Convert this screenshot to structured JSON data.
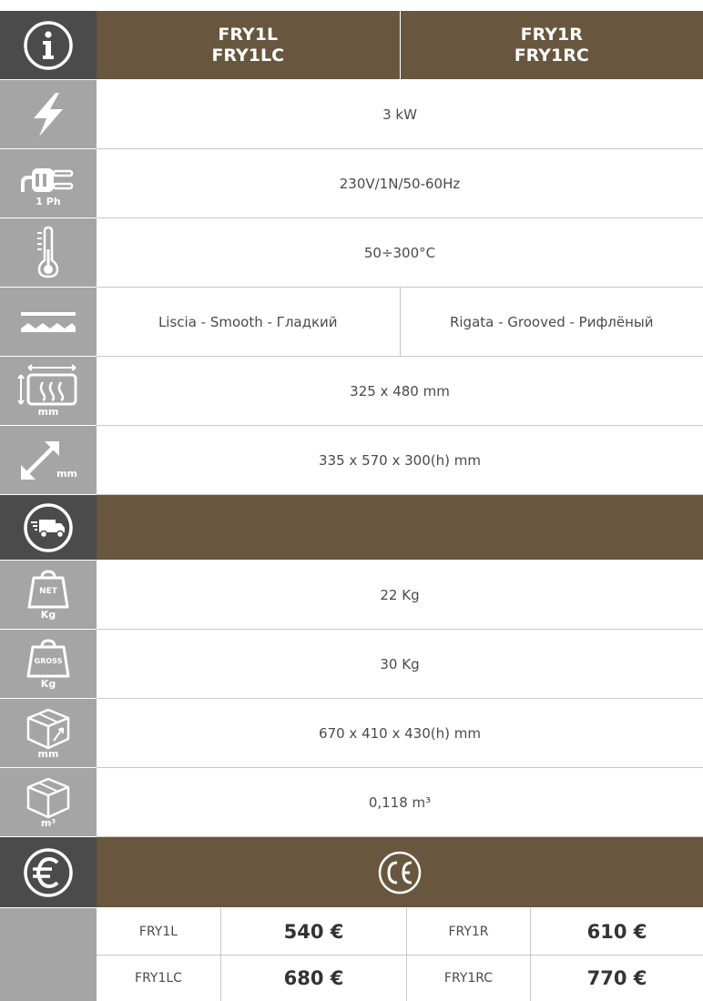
{
  "header": {
    "col1_line1": "FRY1L",
    "col1_line2": "FRY1LC",
    "col2_line1": "FRY1R",
    "col2_line2": "FRY1RC"
  },
  "specs": {
    "power": "3 kW",
    "voltage": "230V/1N/50-60Hz",
    "voltage_icon_label": "1 Ph",
    "temperature": "50÷300°C",
    "plate_left": "Liscia - Smooth - Гладкий",
    "plate_right": "Rigata - Grooved - Рифлёный",
    "cooking_surface": "325 x 480 mm",
    "cooking_surface_icon_label": "mm",
    "dimensions": "335 x 570 x 300(h) mm",
    "dimensions_icon_label": "mm"
  },
  "shipping": {
    "net_weight": "22 Kg",
    "net_icon_top": "NET",
    "net_icon_bottom": "Kg",
    "gross_weight": "30 Kg",
    "gross_icon_top": "GROSS",
    "gross_icon_bottom": "Kg",
    "package_dimensions": "670 x 410 x 430(h) mm",
    "package_dim_icon_label": "mm",
    "volume": "0,118 m³",
    "volume_icon_label": "m³"
  },
  "prices": {
    "rows": [
      {
        "model_a": "FRY1L",
        "price_a": "540 €",
        "model_b": "FRY1R",
        "price_b": "610 €"
      },
      {
        "model_a": "FRY1LC",
        "price_a": "680 €",
        "model_b": "FRY1RC",
        "price_b": "770 €"
      }
    ]
  },
  "colors": {
    "brown": "#68563f",
    "grey_icon": "#a5a5a5",
    "dark_icon": "#4b4b4b"
  },
  "icons": [
    "info-icon",
    "lightning-icon",
    "plug-icon",
    "thermometer-icon",
    "plate-surface-icon",
    "cooking-area-icon",
    "dimensions-arrow-icon",
    "delivery-truck-icon",
    "net-weight-icon",
    "gross-weight-icon",
    "package-dimensions-icon",
    "package-volume-icon",
    "euro-icon",
    "ce-mark-icon"
  ]
}
